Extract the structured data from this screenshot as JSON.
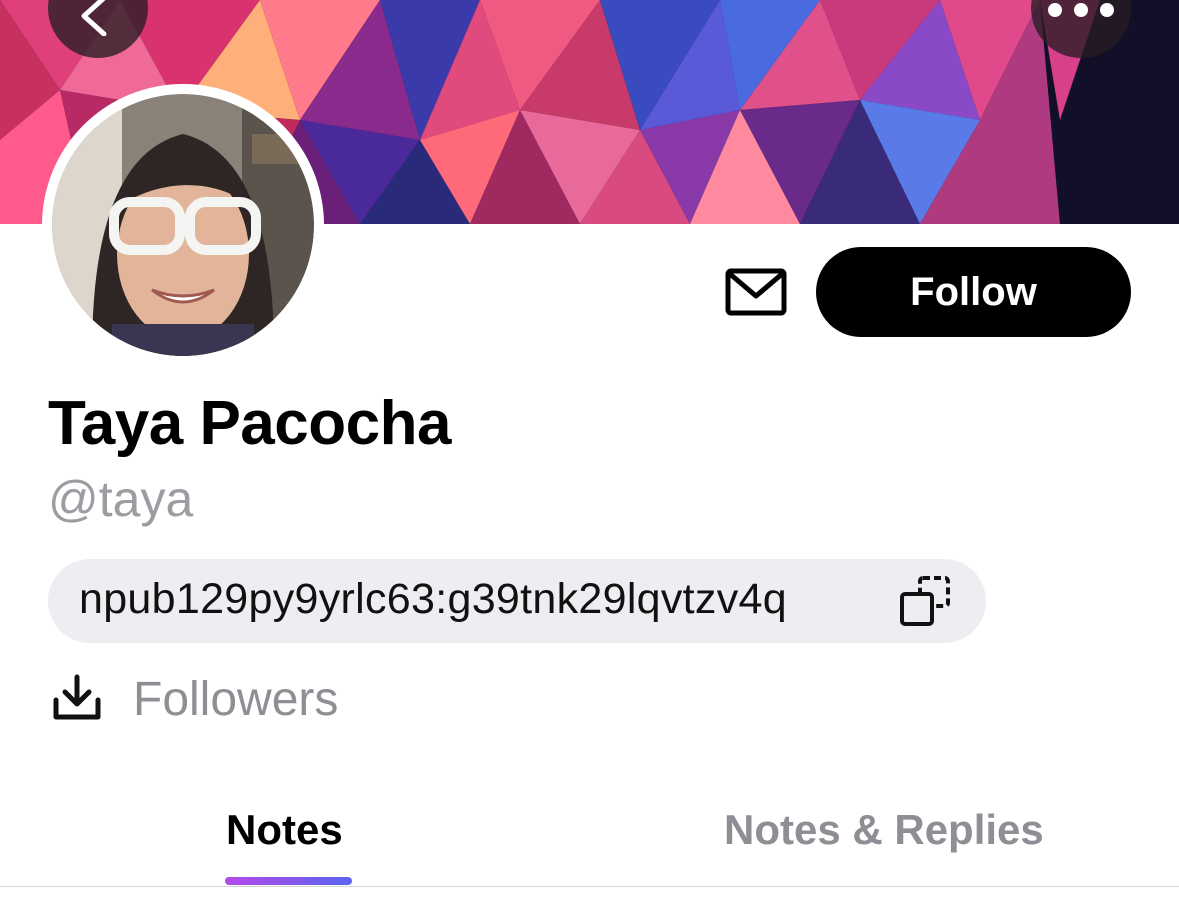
{
  "header": {
    "back_icon": "chevron-left-icon",
    "more_icon": "ellipsis-icon"
  },
  "profile": {
    "display_name": "Taya Pacocha",
    "handle": "@taya",
    "npub": "npub129py9yrlc63:g39tnk29lqvtzv4q",
    "follow_label": "Follow",
    "message_icon": "envelope-icon",
    "copy_icon": "copy-icon",
    "followers_icon": "download-icon",
    "followers_label": "Followers"
  },
  "tabs": [
    {
      "label": "Notes",
      "active": true
    },
    {
      "label": "Notes & Replies",
      "active": false
    }
  ],
  "colors": {
    "follow_button": "#000000",
    "muted_text": "#8e8e94",
    "pill_background": "#ededf2",
    "tab_indicator_start": "#b44ae8",
    "tab_indicator_end": "#5a64f0"
  }
}
